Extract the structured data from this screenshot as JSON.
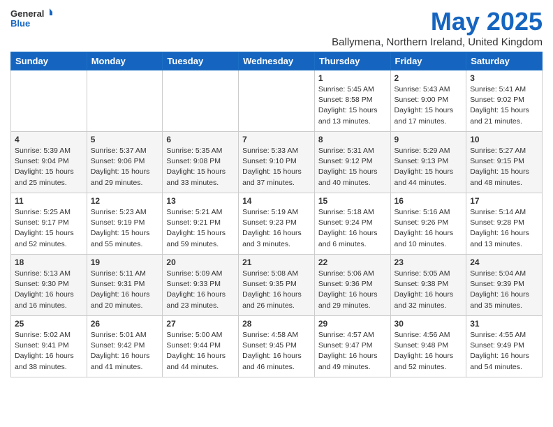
{
  "logo": {
    "general": "General",
    "blue": "Blue"
  },
  "title": "May 2025",
  "subtitle": "Ballymena, Northern Ireland, United Kingdom",
  "days_of_week": [
    "Sunday",
    "Monday",
    "Tuesday",
    "Wednesday",
    "Thursday",
    "Friday",
    "Saturday"
  ],
  "weeks": [
    [
      {
        "day": "",
        "info": ""
      },
      {
        "day": "",
        "info": ""
      },
      {
        "day": "",
        "info": ""
      },
      {
        "day": "",
        "info": ""
      },
      {
        "day": "1",
        "info": "Sunrise: 5:45 AM\nSunset: 8:58 PM\nDaylight: 15 hours\nand 13 minutes."
      },
      {
        "day": "2",
        "info": "Sunrise: 5:43 AM\nSunset: 9:00 PM\nDaylight: 15 hours\nand 17 minutes."
      },
      {
        "day": "3",
        "info": "Sunrise: 5:41 AM\nSunset: 9:02 PM\nDaylight: 15 hours\nand 21 minutes."
      }
    ],
    [
      {
        "day": "4",
        "info": "Sunrise: 5:39 AM\nSunset: 9:04 PM\nDaylight: 15 hours\nand 25 minutes."
      },
      {
        "day": "5",
        "info": "Sunrise: 5:37 AM\nSunset: 9:06 PM\nDaylight: 15 hours\nand 29 minutes."
      },
      {
        "day": "6",
        "info": "Sunrise: 5:35 AM\nSunset: 9:08 PM\nDaylight: 15 hours\nand 33 minutes."
      },
      {
        "day": "7",
        "info": "Sunrise: 5:33 AM\nSunset: 9:10 PM\nDaylight: 15 hours\nand 37 minutes."
      },
      {
        "day": "8",
        "info": "Sunrise: 5:31 AM\nSunset: 9:12 PM\nDaylight: 15 hours\nand 40 minutes."
      },
      {
        "day": "9",
        "info": "Sunrise: 5:29 AM\nSunset: 9:13 PM\nDaylight: 15 hours\nand 44 minutes."
      },
      {
        "day": "10",
        "info": "Sunrise: 5:27 AM\nSunset: 9:15 PM\nDaylight: 15 hours\nand 48 minutes."
      }
    ],
    [
      {
        "day": "11",
        "info": "Sunrise: 5:25 AM\nSunset: 9:17 PM\nDaylight: 15 hours\nand 52 minutes."
      },
      {
        "day": "12",
        "info": "Sunrise: 5:23 AM\nSunset: 9:19 PM\nDaylight: 15 hours\nand 55 minutes."
      },
      {
        "day": "13",
        "info": "Sunrise: 5:21 AM\nSunset: 9:21 PM\nDaylight: 15 hours\nand 59 minutes."
      },
      {
        "day": "14",
        "info": "Sunrise: 5:19 AM\nSunset: 9:23 PM\nDaylight: 16 hours\nand 3 minutes."
      },
      {
        "day": "15",
        "info": "Sunrise: 5:18 AM\nSunset: 9:24 PM\nDaylight: 16 hours\nand 6 minutes."
      },
      {
        "day": "16",
        "info": "Sunrise: 5:16 AM\nSunset: 9:26 PM\nDaylight: 16 hours\nand 10 minutes."
      },
      {
        "day": "17",
        "info": "Sunrise: 5:14 AM\nSunset: 9:28 PM\nDaylight: 16 hours\nand 13 minutes."
      }
    ],
    [
      {
        "day": "18",
        "info": "Sunrise: 5:13 AM\nSunset: 9:30 PM\nDaylight: 16 hours\nand 16 minutes."
      },
      {
        "day": "19",
        "info": "Sunrise: 5:11 AM\nSunset: 9:31 PM\nDaylight: 16 hours\nand 20 minutes."
      },
      {
        "day": "20",
        "info": "Sunrise: 5:09 AM\nSunset: 9:33 PM\nDaylight: 16 hours\nand 23 minutes."
      },
      {
        "day": "21",
        "info": "Sunrise: 5:08 AM\nSunset: 9:35 PM\nDaylight: 16 hours\nand 26 minutes."
      },
      {
        "day": "22",
        "info": "Sunrise: 5:06 AM\nSunset: 9:36 PM\nDaylight: 16 hours\nand 29 minutes."
      },
      {
        "day": "23",
        "info": "Sunrise: 5:05 AM\nSunset: 9:38 PM\nDaylight: 16 hours\nand 32 minutes."
      },
      {
        "day": "24",
        "info": "Sunrise: 5:04 AM\nSunset: 9:39 PM\nDaylight: 16 hours\nand 35 minutes."
      }
    ],
    [
      {
        "day": "25",
        "info": "Sunrise: 5:02 AM\nSunset: 9:41 PM\nDaylight: 16 hours\nand 38 minutes."
      },
      {
        "day": "26",
        "info": "Sunrise: 5:01 AM\nSunset: 9:42 PM\nDaylight: 16 hours\nand 41 minutes."
      },
      {
        "day": "27",
        "info": "Sunrise: 5:00 AM\nSunset: 9:44 PM\nDaylight: 16 hours\nand 44 minutes."
      },
      {
        "day": "28",
        "info": "Sunrise: 4:58 AM\nSunset: 9:45 PM\nDaylight: 16 hours\nand 46 minutes."
      },
      {
        "day": "29",
        "info": "Sunrise: 4:57 AM\nSunset: 9:47 PM\nDaylight: 16 hours\nand 49 minutes."
      },
      {
        "day": "30",
        "info": "Sunrise: 4:56 AM\nSunset: 9:48 PM\nDaylight: 16 hours\nand 52 minutes."
      },
      {
        "day": "31",
        "info": "Sunrise: 4:55 AM\nSunset: 9:49 PM\nDaylight: 16 hours\nand 54 minutes."
      }
    ]
  ]
}
